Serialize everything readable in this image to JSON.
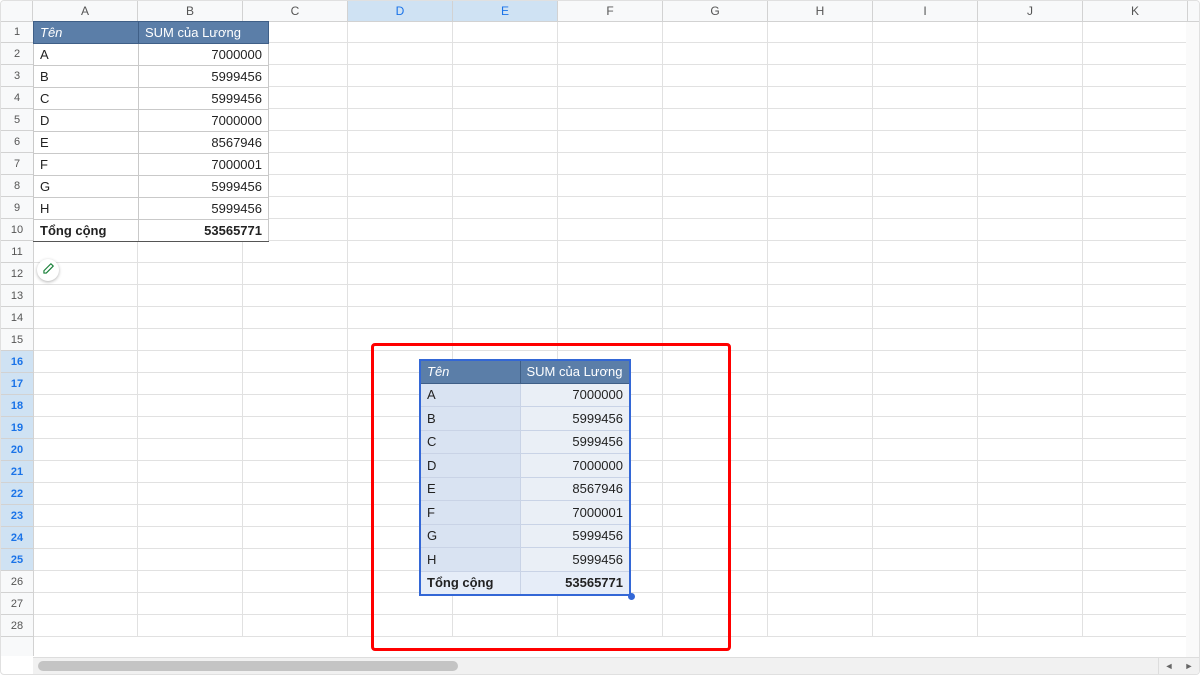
{
  "columns": [
    "A",
    "B",
    "C",
    "D",
    "E",
    "F",
    "G",
    "H",
    "I",
    "J",
    "K"
  ],
  "selected_columns": [
    "D",
    "E"
  ],
  "row_count": 28,
  "selected_rows": [
    16,
    17,
    18,
    19,
    20,
    21,
    22,
    23,
    24,
    25
  ],
  "pivot": {
    "headers": {
      "name": "Tên",
      "sum": "SUM của Lương"
    },
    "rows": [
      {
        "name": "A",
        "value": "7000000"
      },
      {
        "name": "B",
        "value": "5999456"
      },
      {
        "name": "C",
        "value": "5999456"
      },
      {
        "name": "D",
        "value": "7000000"
      },
      {
        "name": "E",
        "value": "8567946"
      },
      {
        "name": "F",
        "value": "7000001"
      },
      {
        "name": "G",
        "value": "5999456"
      },
      {
        "name": "H",
        "value": "5999456"
      }
    ],
    "footer": {
      "label": "Tổng cộng",
      "value": "53565771"
    }
  },
  "icons": {
    "pencil": "pencil-icon",
    "nav_prev": "◄",
    "nav_next": "►"
  }
}
